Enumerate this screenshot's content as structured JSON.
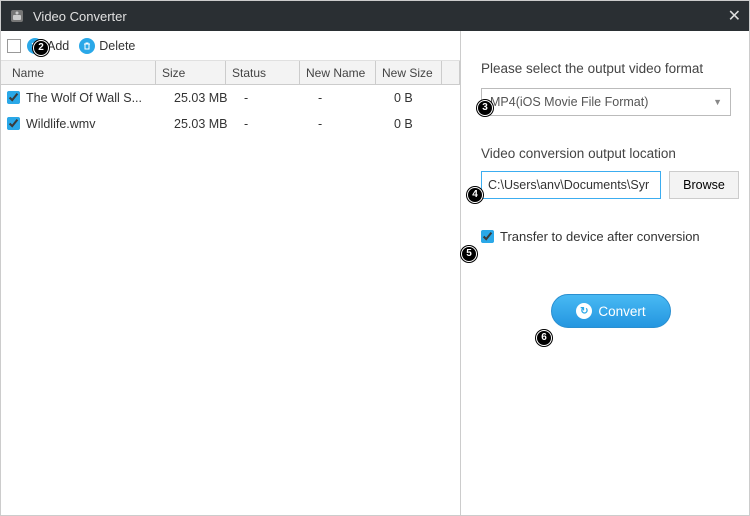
{
  "window": {
    "title": "Video Converter"
  },
  "toolbar": {
    "add_label": "Add",
    "delete_label": "Delete"
  },
  "columns": {
    "name": "Name",
    "size": "Size",
    "status": "Status",
    "newname": "New Name",
    "newsize": "New Size"
  },
  "rows": [
    {
      "name": "The Wolf Of Wall S...",
      "size": "25.03 MB",
      "status": "-",
      "newname": "-",
      "newsize": "0 B"
    },
    {
      "name": "Wildlife.wmv",
      "size": "25.03 MB",
      "status": "-",
      "newname": "-",
      "newsize": "0 B"
    }
  ],
  "right": {
    "format_label": "Please select the output video format",
    "format_value": "MP4(iOS Movie File Format)",
    "loc_label": "Video conversion output location",
    "loc_value": "C:\\Users\\anv\\Documents\\Syr",
    "browse_label": "Browse",
    "transfer_label": "Transfer to device after conversion",
    "convert_label": "Convert"
  },
  "badges": {
    "b2": "2",
    "b3": "3",
    "b4": "4",
    "b5": "5",
    "b6": "6"
  }
}
